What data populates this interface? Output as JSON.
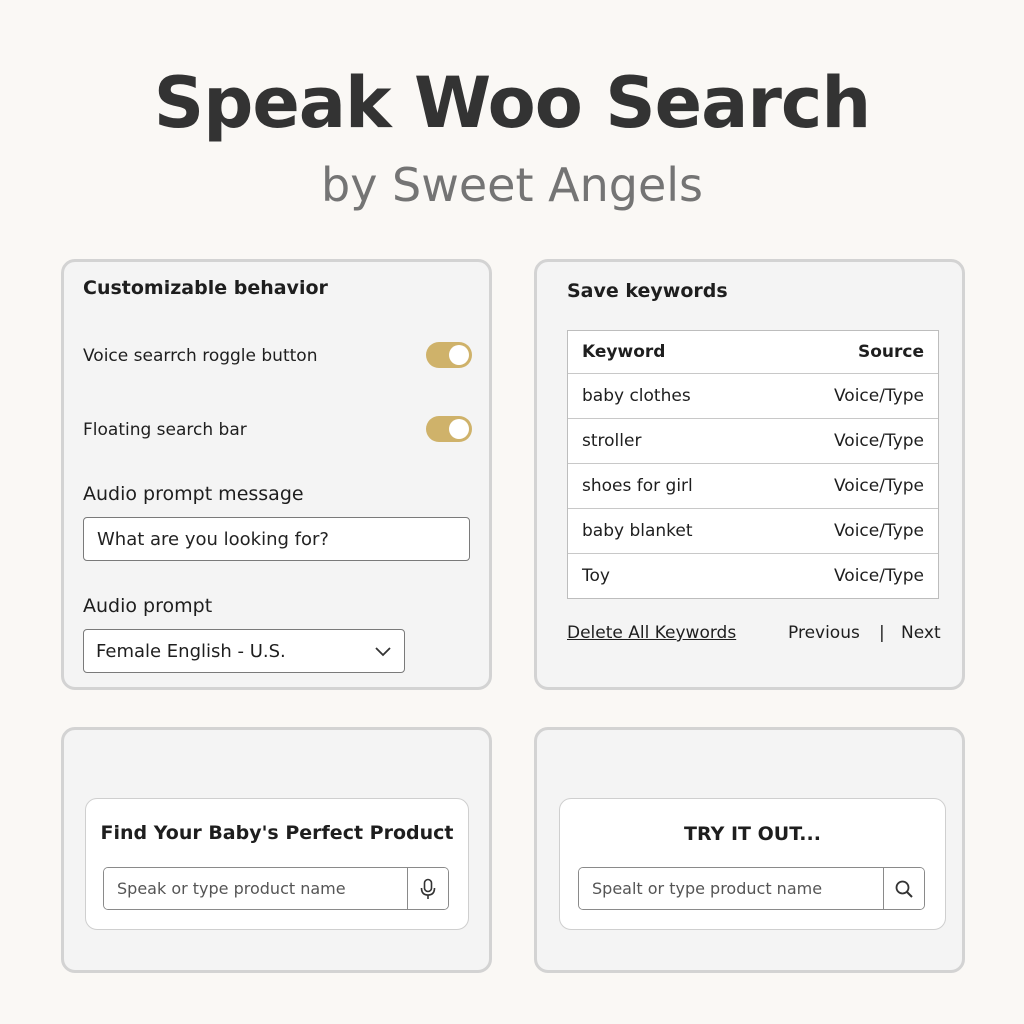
{
  "hero": {
    "title": "Speak Woo Search",
    "subtitle": "by Sweet Angels"
  },
  "behavior": {
    "heading": "Customizable behavior",
    "toggles": [
      {
        "label": "Voice searrch roggle button",
        "on": true
      },
      {
        "label": "Floating search bar",
        "on": true
      }
    ],
    "toggle_color": "#cfb26a",
    "prompt_message_label": "Audio prompt message",
    "prompt_message_value": "What are you looking for?",
    "prompt_label": "Audio prompt",
    "prompt_selected": "Female English - U.S."
  },
  "keywords": {
    "heading": "Save keywords",
    "columns": [
      "Keyword",
      "Source"
    ],
    "rows": [
      {
        "keyword": "baby clothes",
        "source": "Voice/Type"
      },
      {
        "keyword": "stroller",
        "source": "Voice/Type"
      },
      {
        "keyword": "shoes for girl",
        "source": "Voice/Type"
      },
      {
        "keyword": "baby blanket",
        "source": "Voice/Type"
      },
      {
        "keyword": "Toy",
        "source": "Voice/Type"
      }
    ],
    "delete_label": "Delete All Keywords",
    "previous_label": "Previous",
    "separator": "|",
    "next_label": "Next"
  },
  "voice_widget": {
    "title": "Find Your Baby's Perfect Product",
    "placeholder": "Speak or type product name",
    "button_icon": "microphone-icon"
  },
  "try_widget": {
    "title": "TRY IT OUT...",
    "placeholder": "Spealt or type product name",
    "button_icon": "search-icon"
  }
}
